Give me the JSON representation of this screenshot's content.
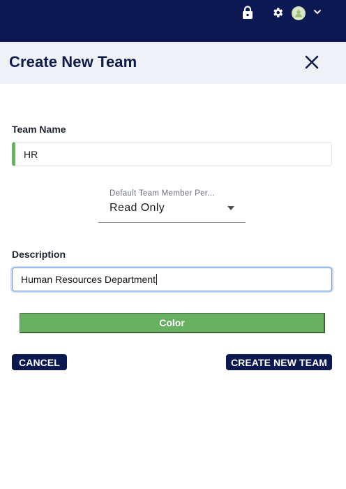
{
  "topbar": {
    "icons": [
      "lock-icon",
      "gear-icon",
      "avatar",
      "chevron-down-icon"
    ],
    "background": "#0b1851"
  },
  "modal": {
    "title": "Create New Team",
    "close_icon": "close-icon"
  },
  "form": {
    "team_name": {
      "label": "Team Name",
      "value": "HR"
    },
    "permission": {
      "label": "Default Team Member Per...",
      "value": "Read Only"
    },
    "description": {
      "label": "Description",
      "value": "Human Resources Department"
    },
    "color_button": {
      "label": "Color",
      "color": "#68b160"
    }
  },
  "actions": {
    "cancel_label": "CANCEL",
    "create_label": "CREATE NEW TEAM"
  },
  "colors": {
    "navy": "#0b1851",
    "accent_green": "#66b35e",
    "focus_blue": "#6e94d9"
  }
}
